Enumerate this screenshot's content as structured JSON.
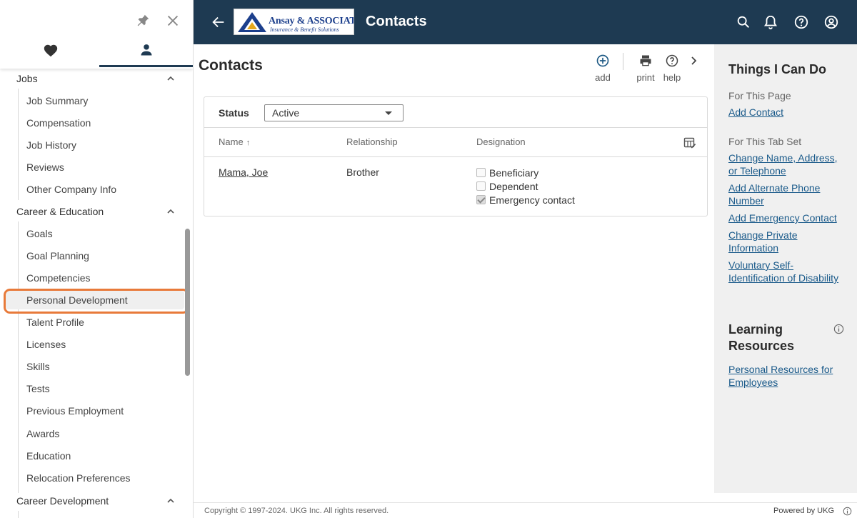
{
  "header": {
    "title": "Contacts",
    "logo_main": "Ansay & ASSOCIATES",
    "logo_sub": "Insurance & Benefit Solutions",
    "bg_color": "#1e3a52"
  },
  "sidebar": {
    "groups": [
      {
        "label": "Jobs",
        "items": [
          "Job Summary",
          "Compensation",
          "Job History",
          "Reviews",
          "Other Company Info"
        ]
      },
      {
        "label": "Career & Education",
        "items": [
          "Goals",
          "Goal Planning",
          "Competencies",
          "Personal Development",
          "Talent Profile",
          "Licenses",
          "Skills",
          "Tests",
          "Previous Employment",
          "Awards",
          "Education",
          "Relocation Preferences"
        ]
      },
      {
        "label": "Career Development",
        "items": []
      }
    ],
    "highlighted_item": "Personal Development",
    "highlight_color": "#e87a3a"
  },
  "page": {
    "title": "Contacts",
    "toolbar": {
      "add": "add",
      "print": "print",
      "help": "help"
    },
    "status_label": "Status",
    "status_value": "Active",
    "columns": {
      "name": "Name",
      "relationship": "Relationship",
      "designation": "Designation"
    },
    "sort_indicator": "↑",
    "rows": [
      {
        "name": "Mama, Joe",
        "relationship": "Brother",
        "designations": [
          {
            "label": "Beneficiary",
            "checked": false
          },
          {
            "label": "Dependent",
            "checked": false
          },
          {
            "label": "Emergency contact",
            "checked": true
          }
        ]
      }
    ]
  },
  "right_panel": {
    "title": "Things I Can Do",
    "for_page": "For This Page",
    "page_links": [
      "Add Contact"
    ],
    "for_tabset": "For This Tab Set",
    "tabset_links": [
      "Change Name, Address, or Telephone",
      "Add Alternate Phone Number",
      "Add Emergency Contact",
      "Change Private Information",
      "Voluntary Self-Identification of Disability"
    ],
    "learning_title": "Learning Resources",
    "learning_links": [
      "Personal Resources for Employees"
    ]
  },
  "footer": {
    "copyright": "Copyright © 1997-2024. UKG Inc. All rights reserved.",
    "powered": "Powered by UKG"
  }
}
